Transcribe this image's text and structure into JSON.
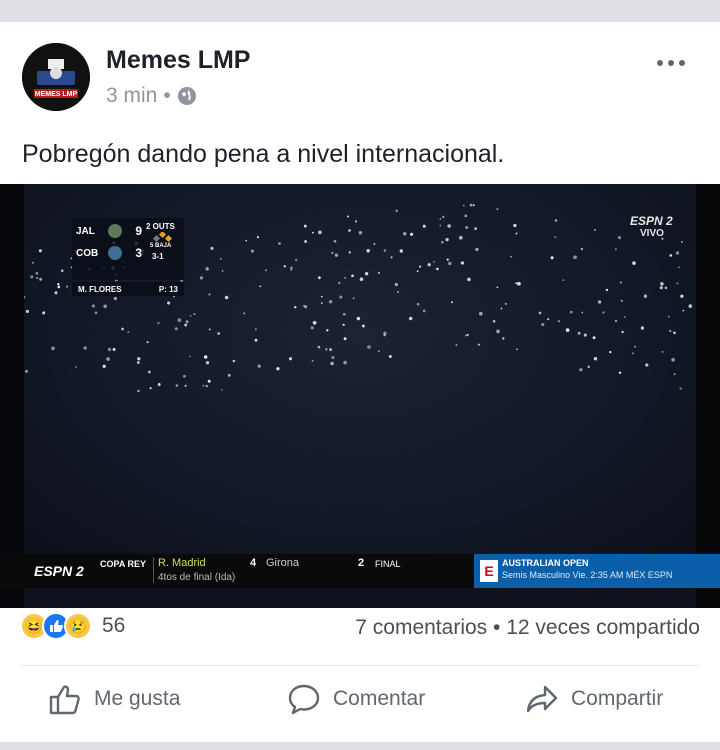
{
  "post": {
    "author": "Memes LMP",
    "time": "3 min",
    "separator": "•",
    "caption": "Pobregón dando pena a nivel internacional.",
    "more_icon": "more-icon",
    "privacy_icon": "globe-icon"
  },
  "avatar": {
    "text": "MEMES LMP"
  },
  "video": {
    "scoreboard": {
      "rows": [
        {
          "team": "JAL",
          "score": "9"
        },
        {
          "team": "COB",
          "score": "3"
        }
      ],
      "outs": "2 OUTS",
      "inning": "5 BAJA",
      "count": "3-1",
      "pitcher": "M. FLORES",
      "pitches": "P: 13"
    },
    "network_logo": "ESPN 2",
    "live": "VIVO",
    "ticker": {
      "brand": "ESPN 2",
      "league": "COPA REY",
      "home": "R. Madrid",
      "home_score": "4",
      "away": "Girona",
      "away_score": "2",
      "status": "FINAL",
      "round": "4tos de final (Ida)",
      "promo_title": "AUSTRALIAN OPEN",
      "promo_sub": "Semis Masculino Vie. 2:35 AM MÉX ESPN"
    }
  },
  "reactions": {
    "icons": [
      "haha-icon",
      "like-icon",
      "sad-icon"
    ],
    "count": "56",
    "comments": "7 comentarios",
    "dot": "•",
    "shares": "12 veces compartido"
  },
  "actions": {
    "like": "Me gusta",
    "comment": "Comentar",
    "share": "Compartir"
  },
  "colors": {
    "brand": "#1877f2",
    "text": "#1d2129",
    "muted": "#606770"
  }
}
